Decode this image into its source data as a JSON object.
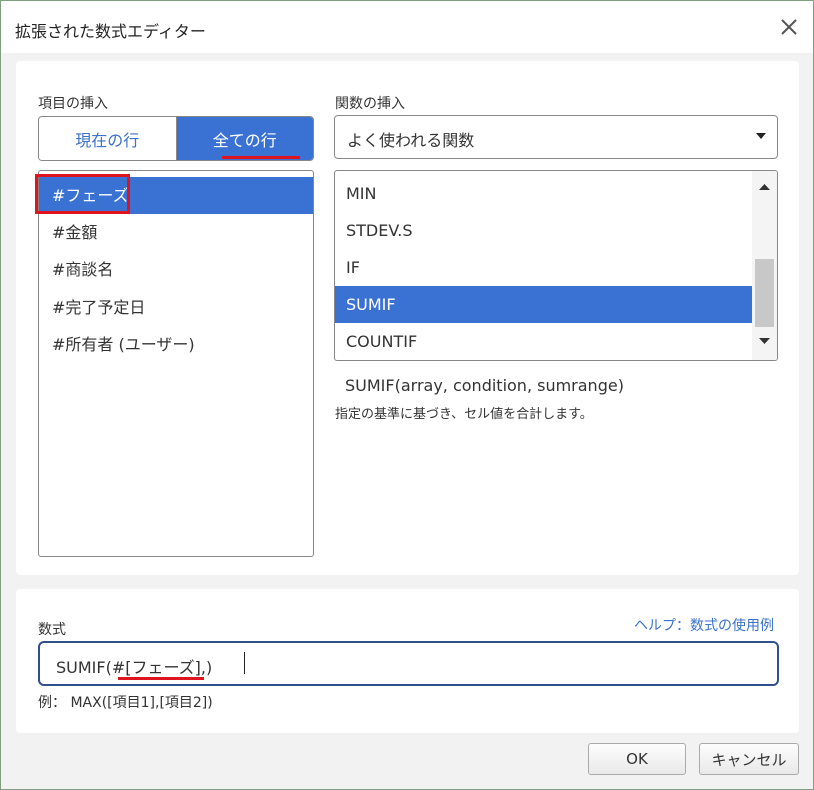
{
  "window": {
    "title": "拡張された数式エディター",
    "close_icon": "close-icon"
  },
  "insert_item": {
    "label": "項目の挿入",
    "toggle": {
      "current_row": "現在の行",
      "all_rows": "全ての行",
      "selected": "all_rows"
    },
    "items": [
      "#フェーズ",
      "#金額",
      "#商談名",
      "#完了予定日",
      "#所有者 (ユーザー)"
    ],
    "selected_index": 0
  },
  "insert_function": {
    "label": "関数の挿入",
    "category": {
      "value": "よく使われる関数"
    },
    "functions": [
      "MIN",
      "STDEV.S",
      "IF",
      "SUMIF",
      "COUNTIF"
    ],
    "selected_index": 3,
    "signature": "SUMIF(array, condition, sumrange)",
    "description": "指定の基準に基づき、セル値を合計します。"
  },
  "formula": {
    "label": "数式",
    "help_link": "ヘルプ：数式の使用例",
    "value": "SUMIF(#[フェーズ],)",
    "example": "例：  MAX([項目1],[項目2])"
  },
  "buttons": {
    "ok": "OK",
    "cancel": "キャンセル"
  },
  "colors": {
    "accent": "#3a72d4",
    "highlight_red": "#e0141e",
    "link": "#3a72cc",
    "formula_border": "#2f4f8f"
  }
}
